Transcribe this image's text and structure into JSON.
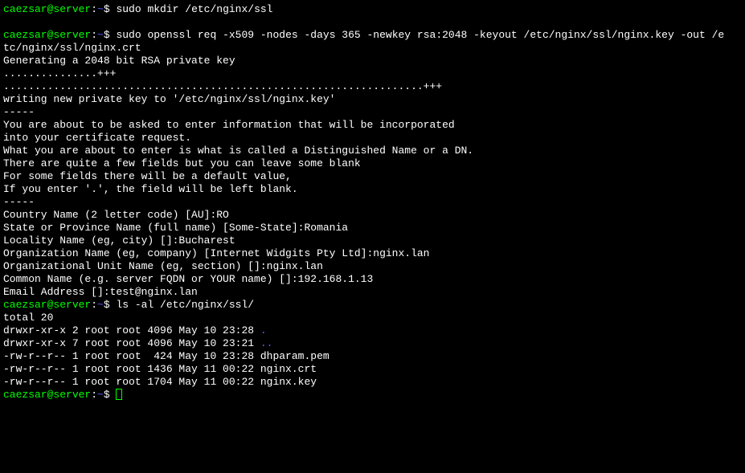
{
  "prompt": {
    "user_host": "caezsar@server",
    "separator": ":",
    "path": "~",
    "symbol": "$ "
  },
  "cmd1": "sudo mkdir /etc/nginx/ssl",
  "cmd2_wrap1": "sudo openssl req -x509 -nodes -days 365 -newkey rsa:2048 -keyout /etc/nginx/ssl/nginx.key -out /e",
  "cmd2_wrap2": "tc/nginx/ssl/nginx.crt",
  "out": {
    "gen": "Generating a 2048 bit RSA private key",
    "dots1": "...............+++",
    "dots2": "...................................................................+++",
    "writing": "writing new private key to '/etc/nginx/ssl/nginx.key'",
    "dash": "-----",
    "about1": "You are about to be asked to enter information that will be incorporated",
    "about2": "into your certificate request.",
    "about3": "What you are about to enter is what is called a Distinguished Name or a DN.",
    "about4": "There are quite a few fields but you can leave some blank",
    "about5": "For some fields there will be a default value,",
    "about6": "If you enter '.', the field will be left blank.",
    "q_country": "Country Name (2 letter code) [AU]:RO",
    "q_state": "State or Province Name (full name) [Some-State]:Romania",
    "q_locality": "Locality Name (eg, city) []:Bucharest",
    "q_org": "Organization Name (eg, company) [Internet Widgits Pty Ltd]:nginx.lan",
    "q_orgunit": "Organizational Unit Name (eg, section) []:nginx.lan",
    "q_cn": "Common Name (e.g. server FQDN or YOUR name) []:192.168.1.13",
    "q_email": "Email Address []:test@nginx.lan"
  },
  "cmd3": "ls -al /etc/nginx/ssl/",
  "ls": {
    "total": "total 20",
    "row1_perm": "drwxr-xr-x 2 root root 4096 May 10 23:28 ",
    "row1_name": ".",
    "row2_perm": "drwxr-xr-x 7 root root 4096 May 10 23:21 ",
    "row2_name": "..",
    "row3": "-rw-r--r-- 1 root root  424 May 10 23:28 dhparam.pem",
    "row4": "-rw-r--r-- 1 root root 1436 May 11 00:22 nginx.crt",
    "row5": "-rw-r--r-- 1 root root 1704 May 11 00:22 nginx.key"
  }
}
